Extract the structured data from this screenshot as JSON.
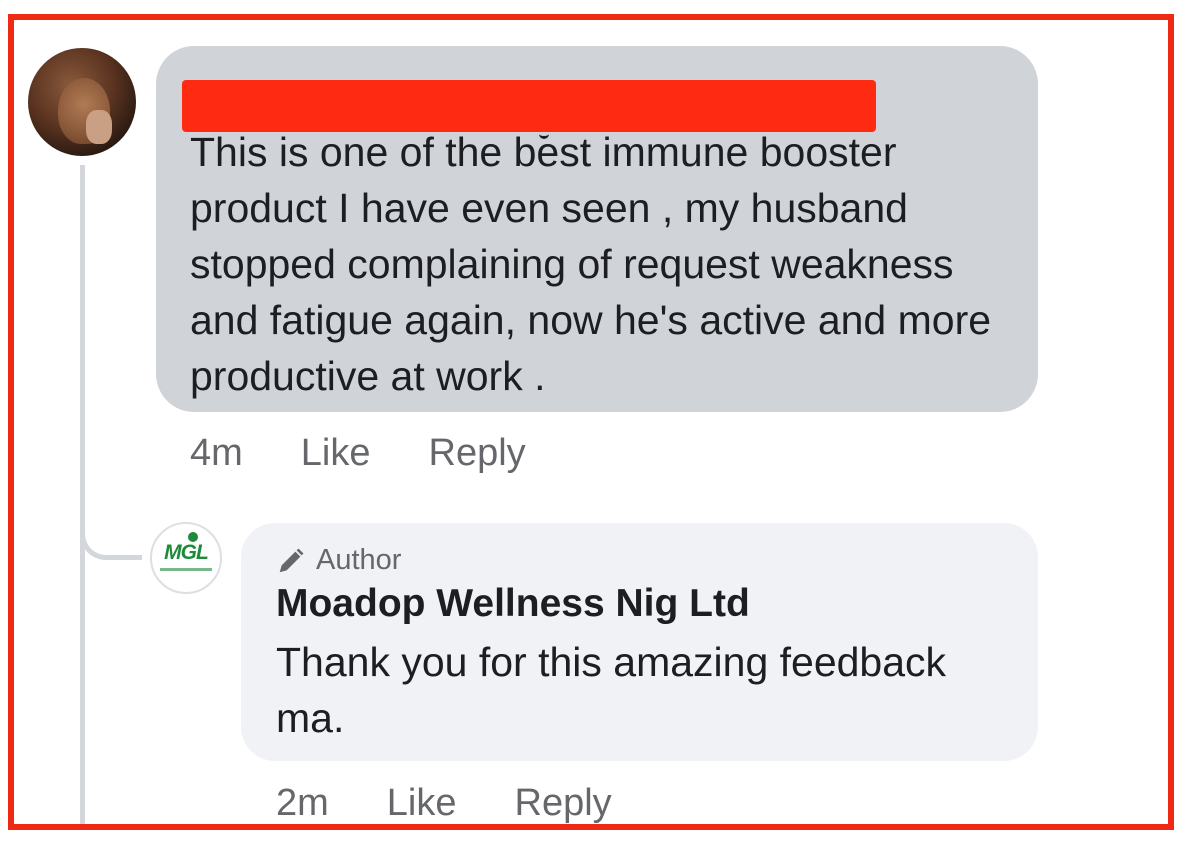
{
  "comment": {
    "author_name_redacted": true,
    "text": "This is one of the best immune booster product I have even seen , my husband stopped complaining of request weakness and fatigue again, now he's active and more productive at work .",
    "time": "4m",
    "like_label": "Like",
    "reply_label": "Reply"
  },
  "reply": {
    "badge": "Author",
    "badge_icon": "pen-icon",
    "author_name": "Moadop Wellness Nig Ltd",
    "avatar_text": "MGL",
    "text": "Thank you for this amazing feedback ma.",
    "time": "2m",
    "like_label": "Like",
    "reply_label": "Reply"
  },
  "colors": {
    "frame_border": "#ef2a14",
    "redaction": "#ff2a12",
    "comment_bubble": "#d0d3d8",
    "reply_bubble": "#f0f2f5",
    "logo_green": "#1e8a3a"
  }
}
